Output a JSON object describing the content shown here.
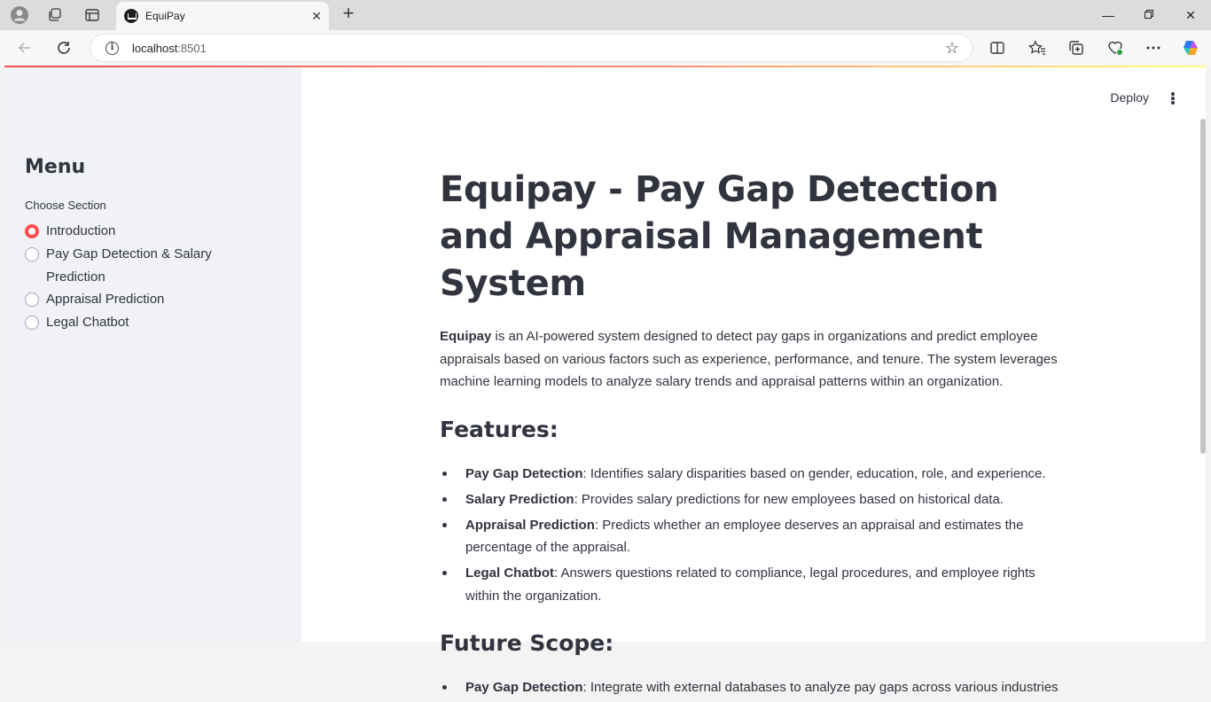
{
  "browser": {
    "tab_title": "EquiPay",
    "url_host": "localhost",
    "url_port": ":8501"
  },
  "colors": {
    "accent": "#ff4b4b",
    "sidebar_bg": "#f0f2f6",
    "text": "#31333f"
  },
  "header": {
    "deploy_label": "Deploy"
  },
  "sidebar": {
    "title": "Menu",
    "radio_label": "Choose Section",
    "options": [
      {
        "label": "Introduction",
        "selected": true
      },
      {
        "label": "Pay Gap Detection & Salary Prediction",
        "selected": false
      },
      {
        "label": "Appraisal Prediction",
        "selected": false
      },
      {
        "label": "Legal Chatbot",
        "selected": false
      }
    ]
  },
  "main": {
    "title": "Equipay - Pay Gap Detection and Appraisal Management System",
    "intro_bold": "Equipay",
    "intro_rest": " is an AI-powered system designed to detect pay gaps in organizations and predict employee appraisals based on various factors such as experience, performance, and tenure. The system leverages machine learning models to analyze salary trends and appraisal patterns within an organization.",
    "features_heading": "Features:",
    "features": [
      {
        "bold": "Pay Gap Detection",
        "text": ": Identifies salary disparities based on gender, education, role, and experience."
      },
      {
        "bold": "Salary Prediction",
        "text": ": Provides salary predictions for new employees based on historical data."
      },
      {
        "bold": "Appraisal Prediction",
        "text": ": Predicts whether an employee deserves an appraisal and estimates the percentage of the appraisal."
      },
      {
        "bold": "Legal Chatbot",
        "text": ": Answers questions related to compliance, legal procedures, and employee rights within the organization."
      }
    ],
    "future_heading": "Future Scope:",
    "future": [
      {
        "bold": "Pay Gap Detection",
        "text": ": Integrate with external databases to analyze pay gaps across various industries"
      }
    ]
  }
}
